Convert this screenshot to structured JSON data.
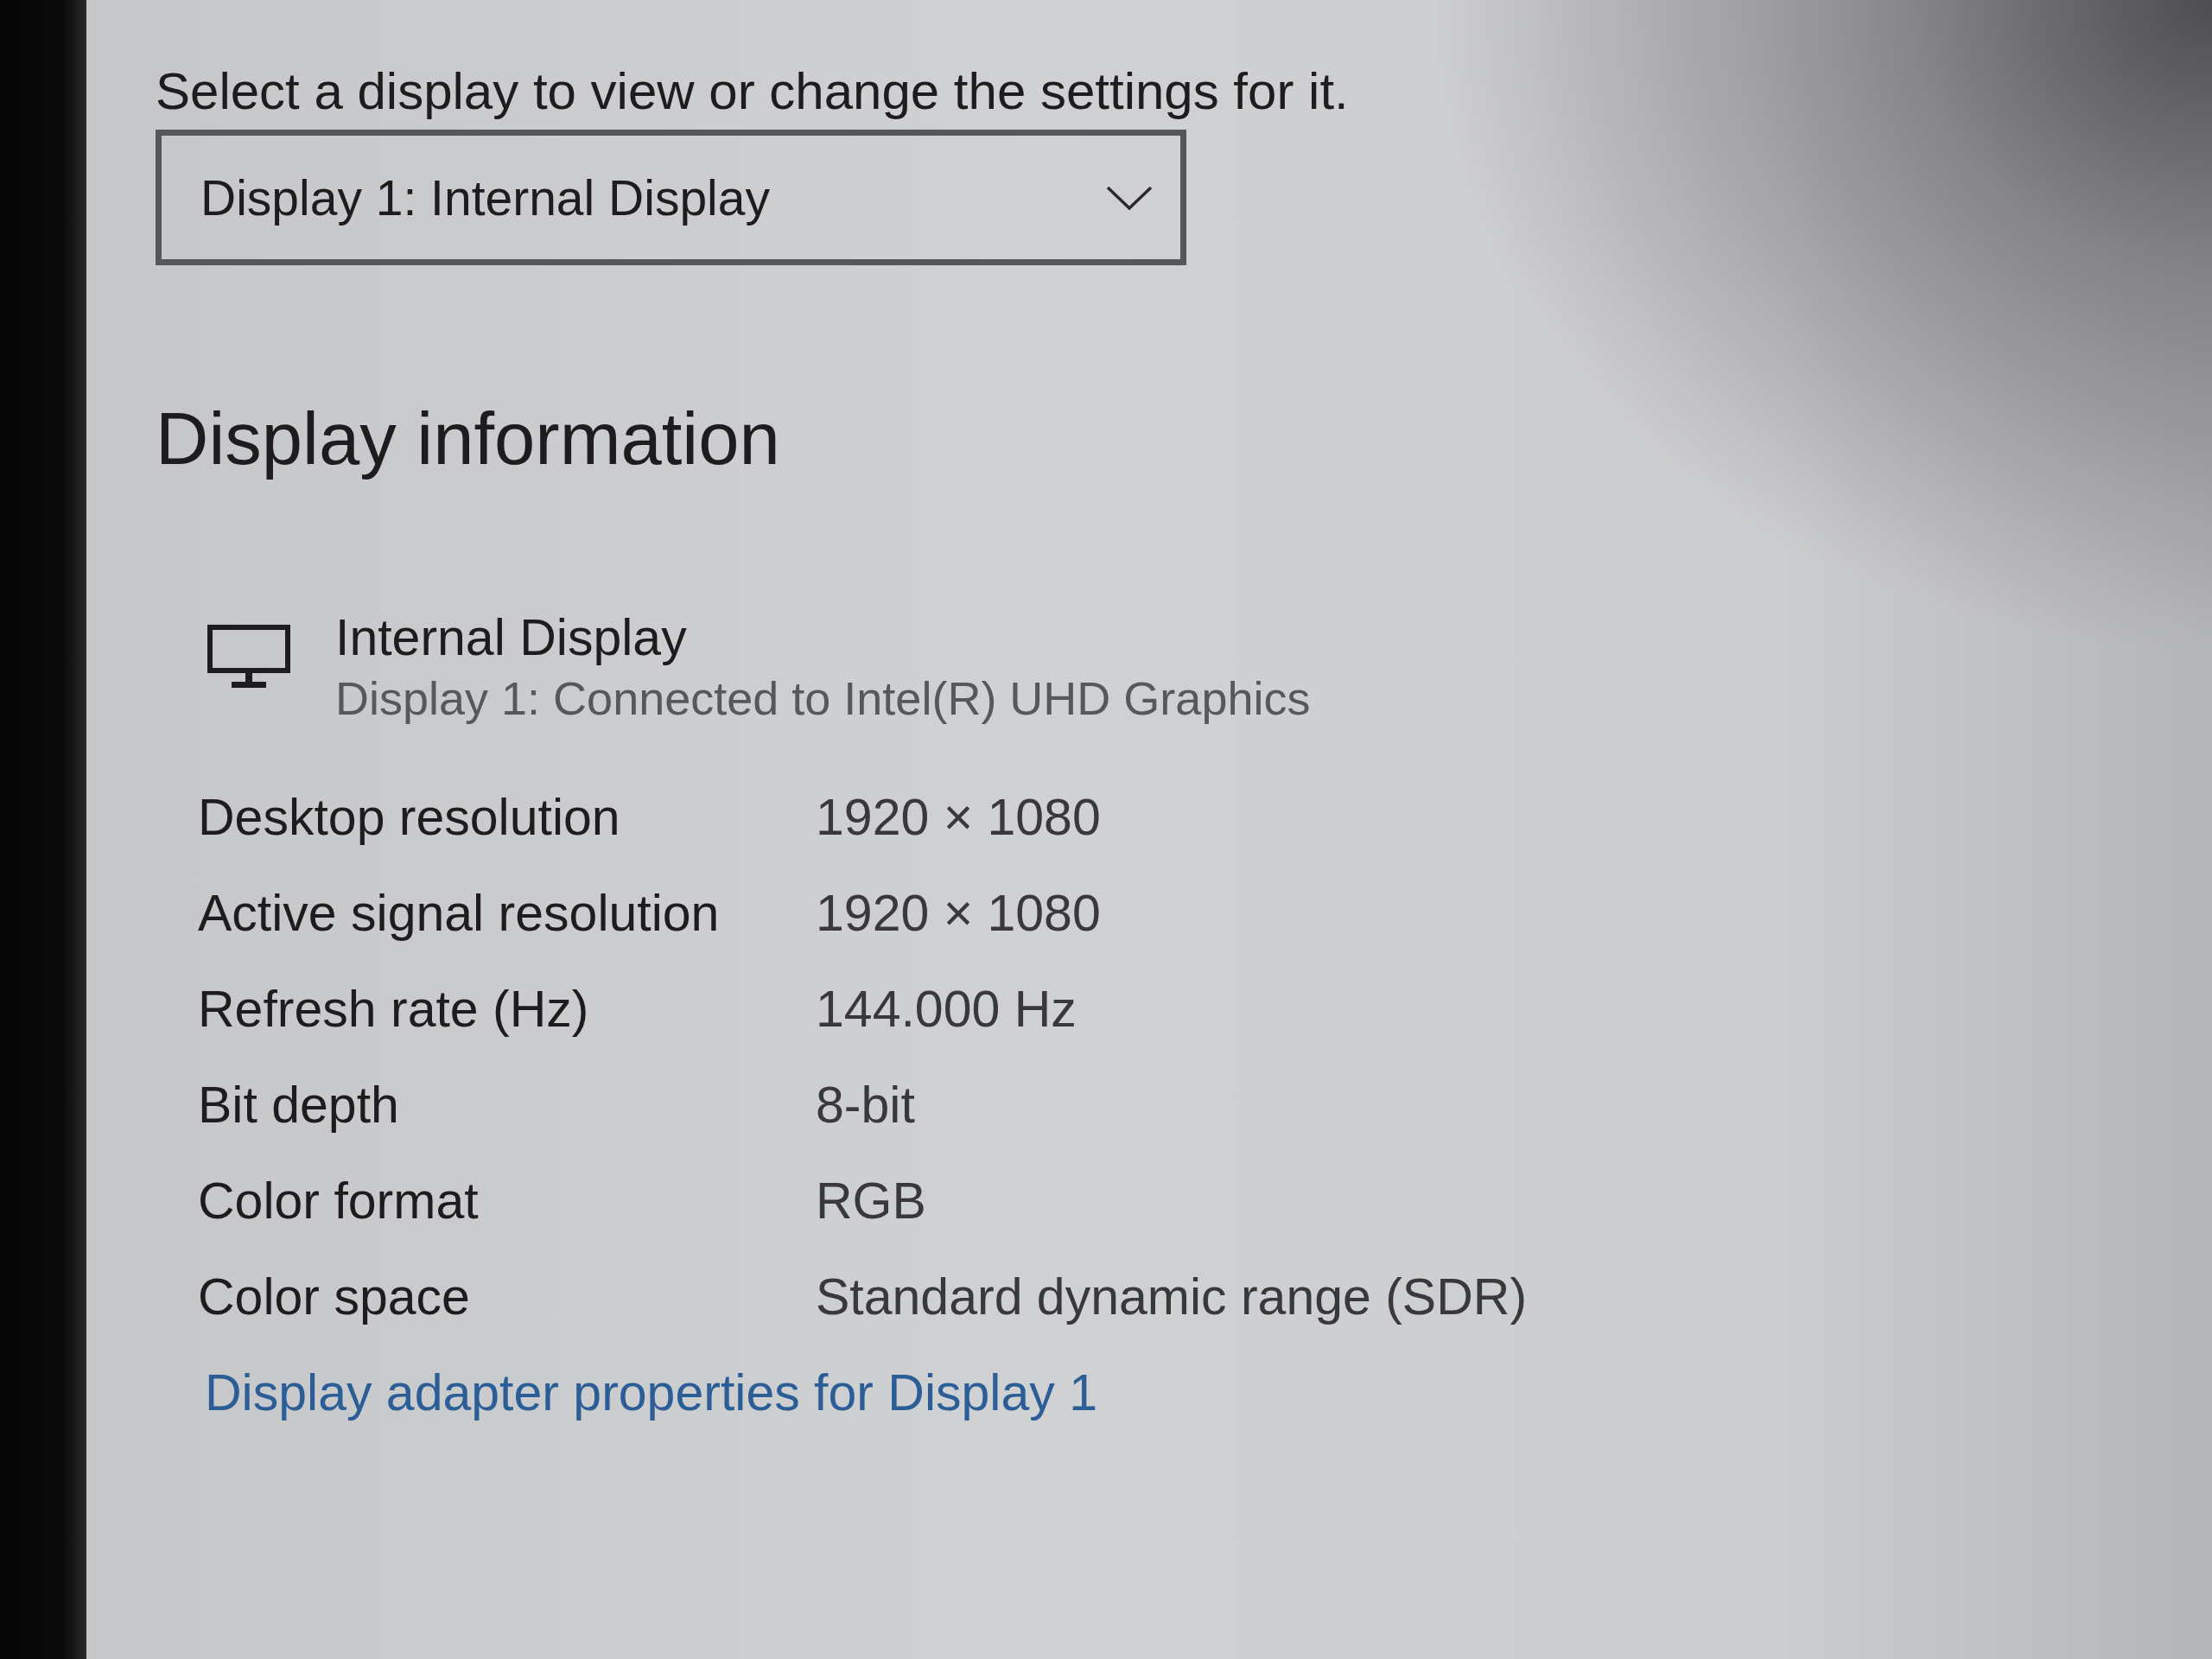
{
  "prompt": "Select a display to view or change the settings for it.",
  "display_select": {
    "value": "Display 1: Internal Display"
  },
  "section_title": "Display information",
  "display": {
    "name": "Internal Display",
    "connection": "Display 1: Connected to Intel(R) UHD Graphics"
  },
  "info_rows": [
    {
      "label": "Desktop resolution",
      "value": "1920 × 1080"
    },
    {
      "label": "Active signal resolution",
      "value": "1920 × 1080"
    },
    {
      "label": "Refresh rate (Hz)",
      "value": "144.000 Hz"
    },
    {
      "label": "Bit depth",
      "value": "8-bit"
    },
    {
      "label": "Color format",
      "value": "RGB"
    },
    {
      "label": "Color space",
      "value": "Standard dynamic range (SDR)"
    }
  ],
  "adapter_link": "Display adapter properties for Display 1"
}
